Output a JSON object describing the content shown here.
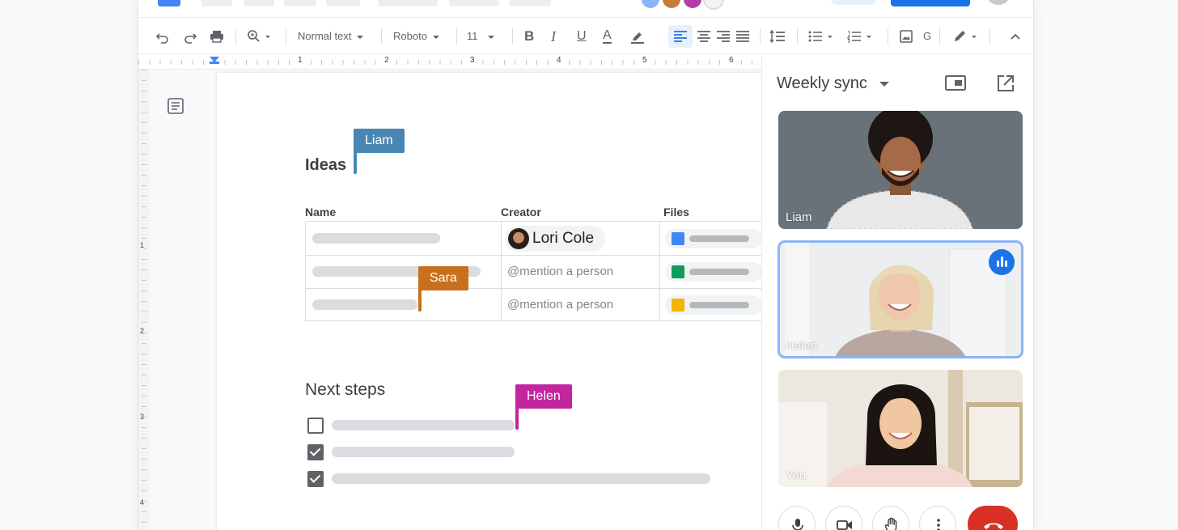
{
  "toolbar": {
    "style_select": "Normal text",
    "font_select": "Roboto",
    "font_size": "11",
    "icons": [
      "undo-icon",
      "redo-icon",
      "print-icon",
      "zoom-icon",
      "bold-icon",
      "italic-icon",
      "underline-icon",
      "text-color-icon",
      "highlight-icon",
      "align-left-icon",
      "align-center-icon",
      "align-right-icon",
      "justify-icon",
      "line-spacing-icon",
      "bulleted-list-icon",
      "numbered-list-icon",
      "image-icon",
      "edit-mode-icon",
      "collapse-icon"
    ]
  },
  "ruler": {
    "numbers": [
      "1",
      "2",
      "3",
      "4",
      "5",
      "6"
    ]
  },
  "vruler": {
    "numbers": [
      "1",
      "2",
      "3",
      "4"
    ]
  },
  "doc": {
    "heading_ideas": "Ideas",
    "table": {
      "headers": [
        "Name",
        "Creator",
        "Files"
      ],
      "creator_chip": "Lori Cole",
      "mention_placeholder": "@mention a person"
    },
    "heading_next": "Next steps",
    "checklist_states": [
      false,
      true,
      true
    ]
  },
  "cursors": [
    {
      "name": "Liam",
      "color": "#4a86b4"
    },
    {
      "name": "Sara",
      "color": "#c8701b"
    },
    {
      "name": "Helen",
      "color": "#c2259e"
    }
  ],
  "meet": {
    "title": "Weekly sync",
    "participants": [
      {
        "label": "Liam",
        "speaking": false
      },
      {
        "label": "Helen",
        "speaking": true
      },
      {
        "label": "You",
        "speaking": false
      }
    ],
    "controls": [
      "microphone-icon",
      "camera-icon",
      "raise-hand-icon",
      "more-options-icon",
      "end-call-icon"
    ]
  },
  "colors": {
    "accent": "#1a73e8",
    "end_call": "#d93025",
    "docs_icon": "#4285f4",
    "sheets_icon": "#0f9d58",
    "slides_icon": "#f4b400"
  }
}
